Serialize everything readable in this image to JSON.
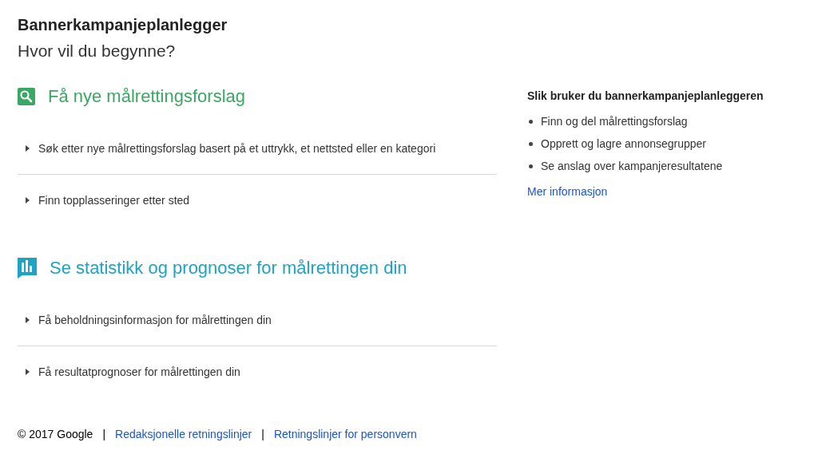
{
  "title": "Bannerkampanjeplanlegger",
  "subtitle": "Hvor vil du begynne?",
  "sections": [
    {
      "kind": "search",
      "color": "#3aa864",
      "heading": "Få nye målrettingsforslag",
      "items": [
        {
          "label": "Søk etter nye målrettingsforslag basert på et uttrykk, et nettsted eller en kategori",
          "expanded": false
        },
        {
          "label": "Finn topplasseringer etter sted",
          "expanded": false
        }
      ]
    },
    {
      "kind": "chart",
      "color": "#1fa3c4",
      "heading": "Se statistikk og prognoser for målrettingen din",
      "items": [
        {
          "label": "Få beholdningsinformasjon for målrettingen din",
          "expanded": false
        },
        {
          "label": "Få resultatprognoser for målrettingen din",
          "expanded": false
        }
      ]
    }
  ],
  "help": {
    "heading": "Slik bruker du bannerkampanjeplanleggeren",
    "bullets": [
      "Finn og del målrettingsforslag",
      "Opprett og lagre annonsegrupper",
      "Se anslag over kampanjeresultatene"
    ],
    "link": "Mer informasjon"
  },
  "footer": {
    "copyright": "© 2017 Google",
    "separators": [
      "|",
      "|"
    ],
    "links": [
      "Redaksjonelle retningslinjer",
      "Retningslinjer for personvern"
    ]
  }
}
